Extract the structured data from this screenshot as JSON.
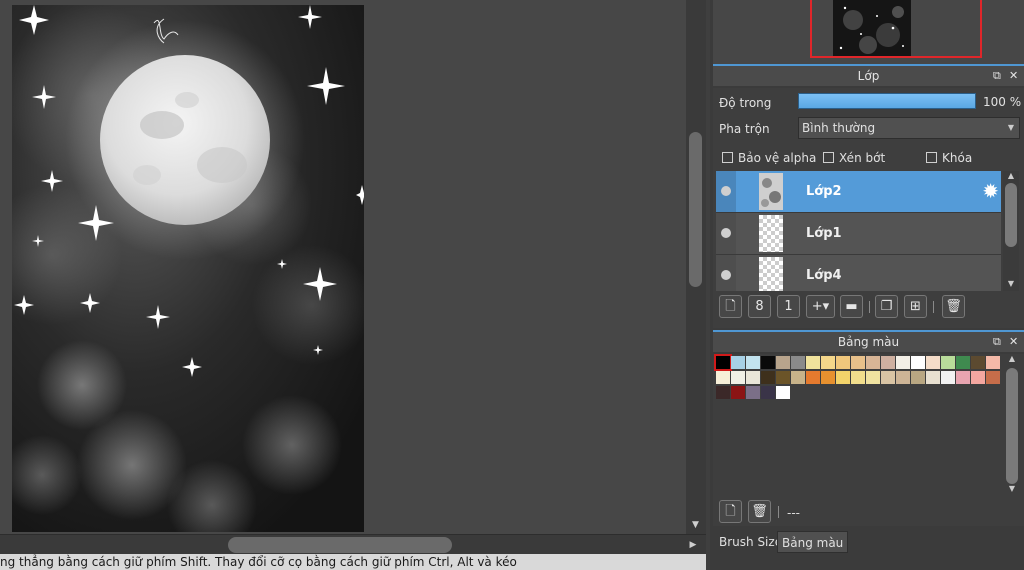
{
  "layer_panel": {
    "title": "Lớp",
    "opacity_label": "Độ trong",
    "opacity_value": "100 %",
    "opacity_fraction": 1.0,
    "blend_label": "Pha trộn",
    "blend_value": "Bình thường",
    "checkbox_protect_alpha": "Bảo vệ alpha",
    "checkbox_clipping": "Xén bớt",
    "checkbox_lock": "Khóa",
    "layers": [
      {
        "name": "Lớp2",
        "selected": true
      },
      {
        "name": "Lớp1",
        "selected": false
      },
      {
        "name": "Lớp4",
        "selected": false
      }
    ]
  },
  "palette_panel": {
    "title": "Bảng màu",
    "empty_label": "---",
    "swatches": [
      [
        "#000000",
        "#a7d1e6",
        "#c2e3ef",
        "#0a0a0a",
        "#b8a48c",
        "#8a8a8a",
        "#f0e29c",
        "#f5d78a",
        "#f0c77c",
        "#e8c08a",
        "#d8b596",
        "#cfb0a0",
        "#f3efe6",
        "#ffffff",
        "#f4dcc8",
        "#b9dc9a",
        "#3f8a4f",
        "#5c4a30",
        "#f4b9a8"
      ],
      [
        "#f7efd8",
        "#f1f1e6",
        "#e9e6d8",
        "#3e301c",
        "#6b5428",
        "#c8b38a",
        "#e57a2e",
        "#e7912f",
        "#f3d36a",
        "#f2de8c",
        "#f0e2a0",
        "#d9c4a4",
        "#cdb496",
        "#b9a782",
        "#e8e0d0",
        "#f2f2f2",
        "#e8a4b0",
        "#f4a7a0",
        "#c66d4a"
      ],
      [
        "#3b2828",
        "#8b1414",
        "#7b6f88",
        "#3a3448",
        "#ffffff"
      ]
    ]
  },
  "bottom_tabs": {
    "brush_size": "Brush Size",
    "palette": "Bảng màu"
  },
  "status_text": "ng thẳng bằng cách giữ phím Shift. Thay đổi cỡ cọ bằng cách giữ phím Ctrl, Alt và kéo"
}
